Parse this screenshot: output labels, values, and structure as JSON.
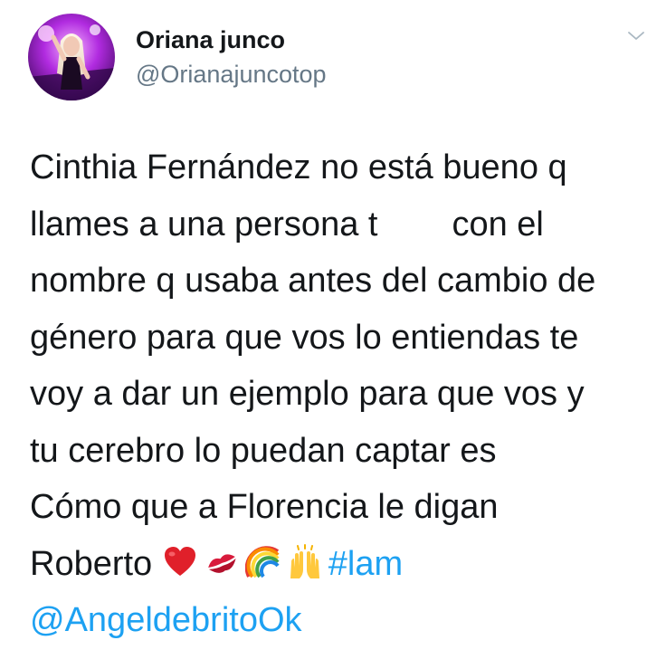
{
  "author": {
    "name": "Oriana junco",
    "handle": "@Orianajuncotop"
  },
  "icons": {
    "menu": "chevron-down-icon",
    "emoji_sequence": [
      "red-heart-icon",
      "kiss-mark-icon",
      "rainbow-icon",
      "raising-hands-icon"
    ]
  },
  "tweet": {
    "line1": "Cinthia Fernández no está bueno q",
    "line2a": "llames a una persona t",
    "line2b": "con el",
    "line3": "nombre q usaba antes del cambio de",
    "line4": "género para que vos lo entiendas te",
    "line5": "voy a dar un ejemplo para que vos y",
    "line6": "tu cerebro lo puedan captar es",
    "line7": "Cómo que a Florencia le digan",
    "line8": "Roberto",
    "hashtag": "#lam",
    "mention": "@AngeldebritoOk"
  },
  "colors": {
    "text": "#14171a",
    "secondary": "#657786",
    "link": "#1da1f2",
    "background": "#ffffff"
  }
}
